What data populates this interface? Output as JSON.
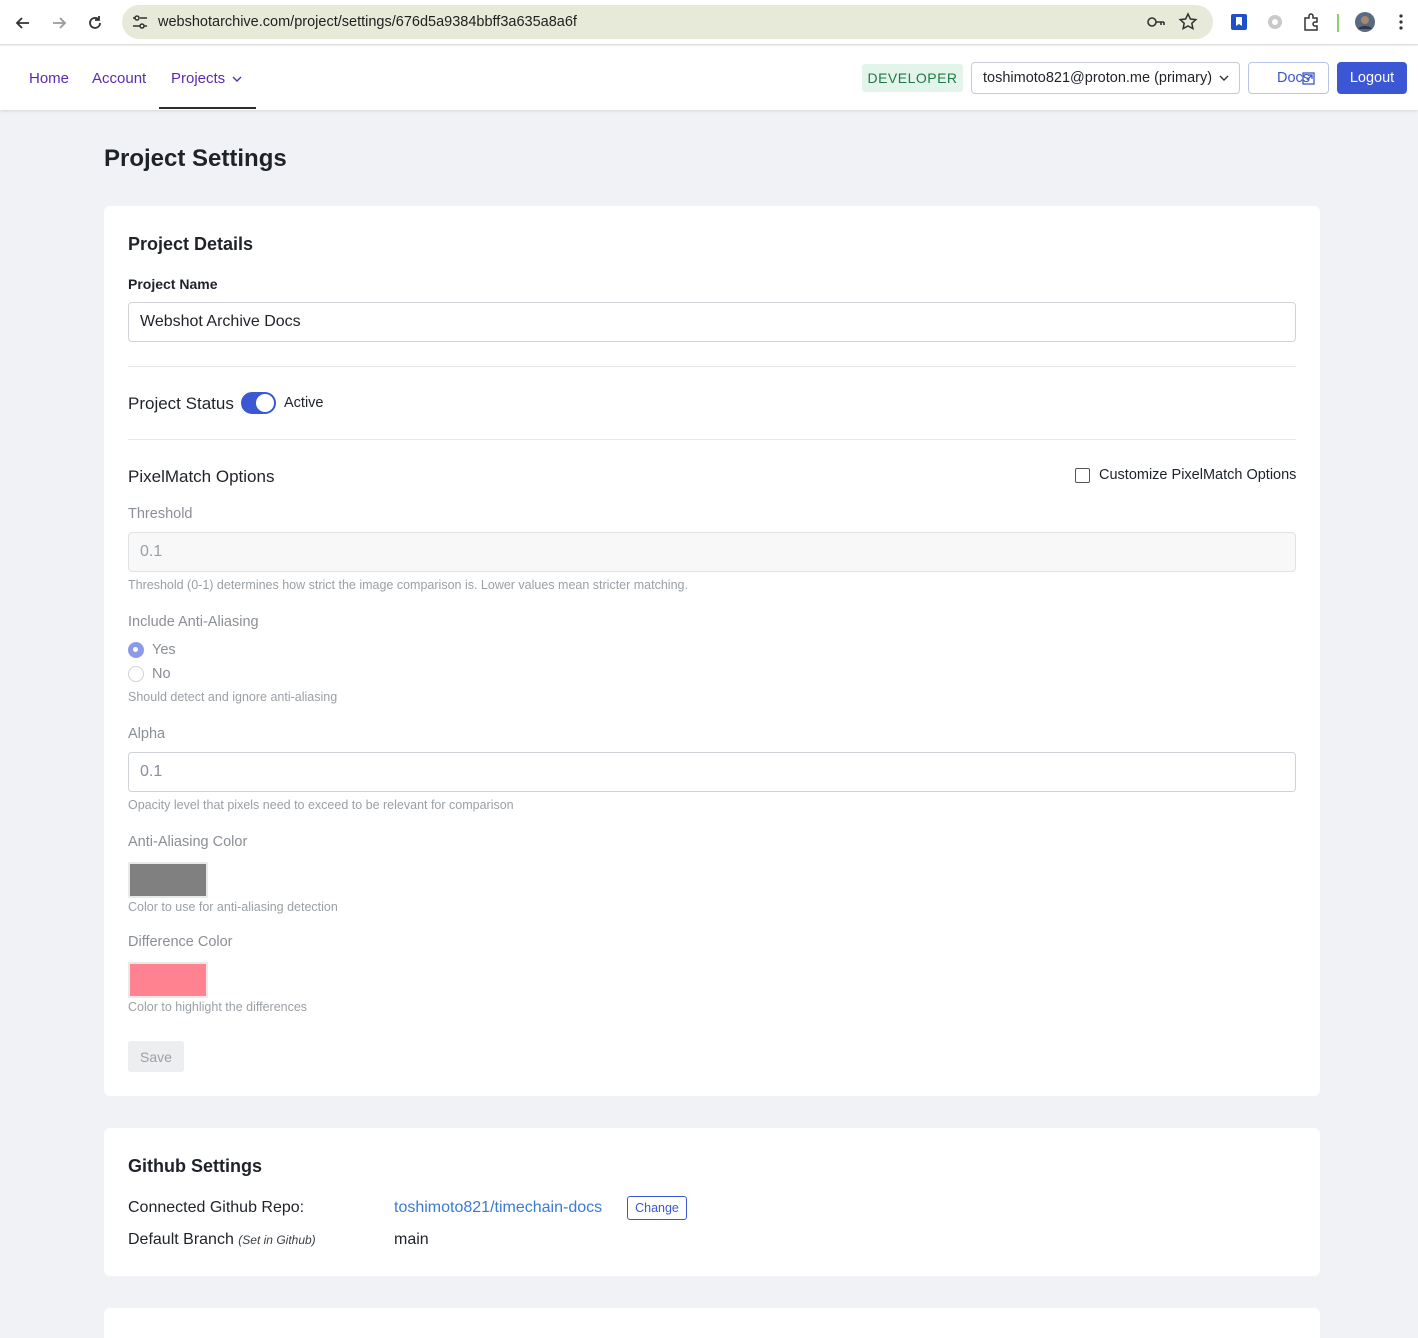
{
  "browser": {
    "url": "webshotarchive.com/project/settings/676d5a9384bbff3a635a8a6f"
  },
  "nav": {
    "home": "Home",
    "account": "Account",
    "projects": "Projects",
    "role_badge": "DEVELOPER",
    "account_select": "toshimoto821@proton.me (primary)",
    "docs": "Docs",
    "logout": "Logout"
  },
  "page": {
    "title": "Project Settings"
  },
  "project_details": {
    "title": "Project Details",
    "name_label": "Project Name",
    "name_value": "Webshot Archive Docs",
    "status_label": "Project Status",
    "status_value": "Active",
    "status_on": true
  },
  "pixelmatch": {
    "title": "PixelMatch Options",
    "customize_label": "Customize PixelMatch Options",
    "customize_checked": false,
    "threshold_label": "Threshold",
    "threshold_value": "0.1",
    "threshold_hint": "Threshold (0-1) determines how strict the image comparison is. Lower values mean stricter matching.",
    "aa_label": "Include Anti-Aliasing",
    "aa_yes": "Yes",
    "aa_no": "No",
    "aa_selected": "Yes",
    "aa_hint": "Should detect and ignore anti-aliasing",
    "alpha_label": "Alpha",
    "alpha_value": "0.1",
    "alpha_hint": "Opacity level that pixels need to exceed to be relevant for comparison",
    "aa_color_label": "Anti-Aliasing Color",
    "aa_color": "#808080",
    "aa_color_hint": "Color to use for anti-aliasing detection",
    "diff_color_label": "Difference Color",
    "diff_color": "#ff8290",
    "diff_color_hint": "Color to highlight the differences",
    "save": "Save"
  },
  "github": {
    "title": "Github Settings",
    "repo_label": "Connected Github Repo:",
    "repo_value": "toshimoto821/timechain-docs",
    "change": "Change",
    "branch_label": "Default Branch",
    "branch_note": "(Set in Github)",
    "branch_value": "main"
  },
  "colors": {
    "accent": "#3b57d3",
    "nav_link": "#5b2bb3",
    "badge_bg": "#e3f4ea",
    "badge_text": "#1e7a47"
  }
}
